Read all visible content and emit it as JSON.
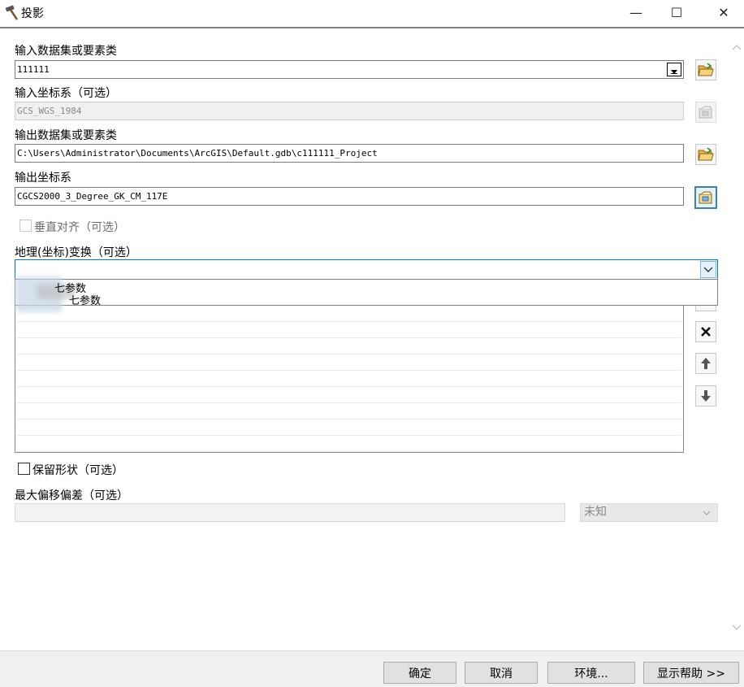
{
  "window": {
    "title": "投影",
    "minimize": "—",
    "maximize": "☐",
    "close": "✕"
  },
  "input_dataset": {
    "label": "输入数据集或要素类",
    "value": "111111"
  },
  "input_cs": {
    "label": "输入坐标系（可选）",
    "value": "GCS_WGS_1984"
  },
  "output_dataset": {
    "label": "输出数据集或要素类",
    "value": "C:\\Users\\Administrator\\Documents\\ArcGIS\\Default.gdb\\c111111_Project"
  },
  "output_cs": {
    "label": "输出坐标系",
    "value": "CGCS2000_3_Degree_GK_CM_117E"
  },
  "vertical": {
    "label": "垂直对齐（可选）",
    "checked": false
  },
  "transform": {
    "label": "地理(坐标)变换（可选）",
    "value": "",
    "options": [
      "七参数",
      "七参数"
    ]
  },
  "preserve_shape": {
    "label": "保留形状（可选）",
    "checked": false
  },
  "max_offset": {
    "label": "最大偏移偏差（可选）",
    "value": "",
    "unit": "未知"
  },
  "footer": {
    "ok": "确定",
    "cancel": "取消",
    "env": "环境...",
    "help": "显示帮助 >>"
  },
  "colors": {
    "accent": "#0078d7",
    "folder": "#e3a21a"
  },
  "icons": {
    "app": "hammer-icon",
    "browse": "folder-open-icon",
    "properties": "spatial-reference-icon",
    "remove": "x-icon",
    "up": "arrow-up-icon",
    "down": "arrow-down-icon"
  }
}
